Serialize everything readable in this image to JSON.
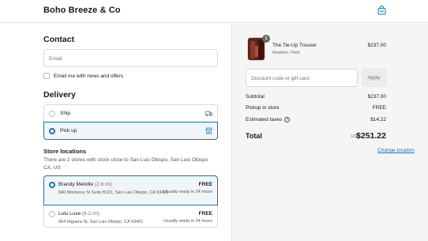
{
  "header": {
    "brand": "Boho Breeze & Co",
    "cart_icon": "shopping-bag-icon"
  },
  "contact": {
    "title": "Contact",
    "email": {
      "placeholder": "Email",
      "value": ""
    },
    "newsletter": {
      "label": "Email me with news and offers",
      "checked": false
    }
  },
  "delivery": {
    "title": "Delivery",
    "options": [
      {
        "label": "Ship",
        "icon": "truck-icon",
        "selected": false
      },
      {
        "label": "Pick up",
        "icon": "store-icon",
        "selected": true
      }
    ]
  },
  "stores": {
    "title": "Store locations",
    "change_link": "Change location",
    "note": "There are 2 stores with stock close to San Luis Obispo, San Luis Obispo CA, US",
    "items": [
      {
        "name": "Brandy Melville",
        "distance": "(2.6 mi)",
        "address": "840 Monterey St Suite B101, San Luis Obispo, CA 93401",
        "price": "FREE",
        "ready": "Usually ready in 24 hours",
        "selected": true
      },
      {
        "name": "Lulu Luxe",
        "distance": "(6.2 mi)",
        "address": "864 Higuera St, San Luis Obispo, CA 93401",
        "price": "FREE",
        "ready": "Usually ready in 24 hours",
        "selected": false
      }
    ]
  },
  "summary": {
    "product": {
      "name": "The Tie-Up Trouser",
      "variant": "Medium / Red",
      "price": "$237.00",
      "quantity": "1"
    },
    "discount": {
      "placeholder": "Discount code or gift card",
      "apply_label": "Apply"
    },
    "rows": [
      {
        "label": "Subtotal",
        "value": "$237.00"
      },
      {
        "label": "Pickup in store",
        "value": "FREE"
      },
      {
        "label": "Estimated taxes",
        "value": "$14.22",
        "info_icon": "?"
      }
    ],
    "total": {
      "label": "Total",
      "currency": "USD",
      "value": "$251.22"
    }
  },
  "colors": {
    "accent": "#1773b0",
    "sidebar_bg": "#f5f5f5",
    "selected_bg": "#f0f5fa"
  }
}
